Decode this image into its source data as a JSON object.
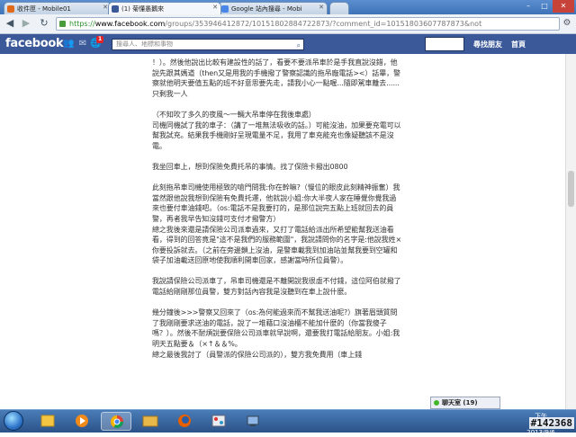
{
  "browser": {
    "tabs": [
      {
        "label": "收件匣 - Mobile01",
        "icon": "mobile01-favicon-icon",
        "active": false
      },
      {
        "label": "(1) 菊懂愚鵝來",
        "icon": "facebook-favicon-icon",
        "active": true
      },
      {
        "label": "Google 站內搜尋 - Mobi",
        "icon": "google-favicon-icon",
        "active": false
      }
    ],
    "window_controls": {
      "minimize": "–",
      "maximize": "□",
      "close": "✕"
    },
    "nav": {
      "back": "◀",
      "forward": "▶",
      "reload": "↻"
    },
    "url": {
      "scheme": "https://",
      "host": "www.facebook.com",
      "path": "/groups/353946412872/10151802884722873/?comment_id=10151803607787873&not"
    },
    "menu_icon": "wrench-icon"
  },
  "facebook": {
    "logo": "facebook",
    "notification_count": "1",
    "search_placeholder": "搜尋人、地標和事物",
    "links": [
      "尋找朋友",
      "首頁"
    ]
  },
  "post": {
    "paragraphs": [
      "！）。然後他說出比較有建設性的話了，看要不要派吊車於是手我直說沒錯，他說先跟其媽道（then又是用我的手機撥了警察認識的拖吊廠電話><）話畢，警察就他明天要值五點的班不好意思要先走，請我小心一點喔...隨即駕車離去......只剩我一人",
      "",
      "（不知吹了多久的夜風～一輛大吊車停在我後車處）",
      "司機同機試了我的車子：（講了一堆無法吸收的話。）可能沒油，加果要充電可以幫我試充。結果我手機剛好呈現電量不足，我用了車充能充也像疑聽該不是沒電。",
      "",
      "我坐回車上，想到保險免費托吊的事情。找了保險卡撥出0800",
      "",
      "此刻拖吊車司機使用極致的嗆門問我:你在幹嘛?（慢位的眼皮此刻精神振奮）我當然跟他說我想到保險有免費托運，他就說小姐:你大半夜人家在睡覺你覺我過來也要付車油錢吧。（os:電話不是我要打的，是那位說完五點上班就回去的員警，再者我早告知沒錢可支付才撥警方）",
      "總之我後來還是請保險公司派車過來，又打了電話給派出所希望能幫我送油看看，得到的回答竟是\"這不是我們的服務範圍\"，我說請問你的名字是:他說我姓×你要投訴就去。（之前在旁邊鎖上沒油，是警車載我到加油站並幫我要到空罐和袋子加油載送回原地使我順利開車回家，感謝當時所位員警）。",
      "",
      "我說請保險公司派車了，吊車司機還是不離開說我很虛不付錢，這位阿伯就撥了電話給剛剛那位員警，雙方對話內容我是沒聽到在車上說什麼。",
      "",
      "幾分鐘後>>>警察又回來了（os:為何能過來而不幫我送油呢?）旗著眉頭質問了我剛剛要求送油的電話，說了一堆藉口沒油櫃不能加什麼的（你當我傻子嗎？）。然後不耐煩說要保險公司派車就早說啊，還要我打電話給朋友。小姐:我明天五點要＆（×↑＆＆%。",
      "總之最後我討了（員警派的保險公司派的），雙方我免費用（車上錢"
    ]
  },
  "chat": {
    "label": "聊天室 (19)"
  },
  "taskbar": {
    "apps": [
      "windows-explorer-icon",
      "media-player-icon",
      "chrome-icon",
      "folder-icon",
      "firefox-icon",
      "paint-icon",
      "network-icon"
    ],
    "clock_time": "下午 09:09",
    "clock_date": "2013/9/6"
  },
  "image_id": "#142368"
}
